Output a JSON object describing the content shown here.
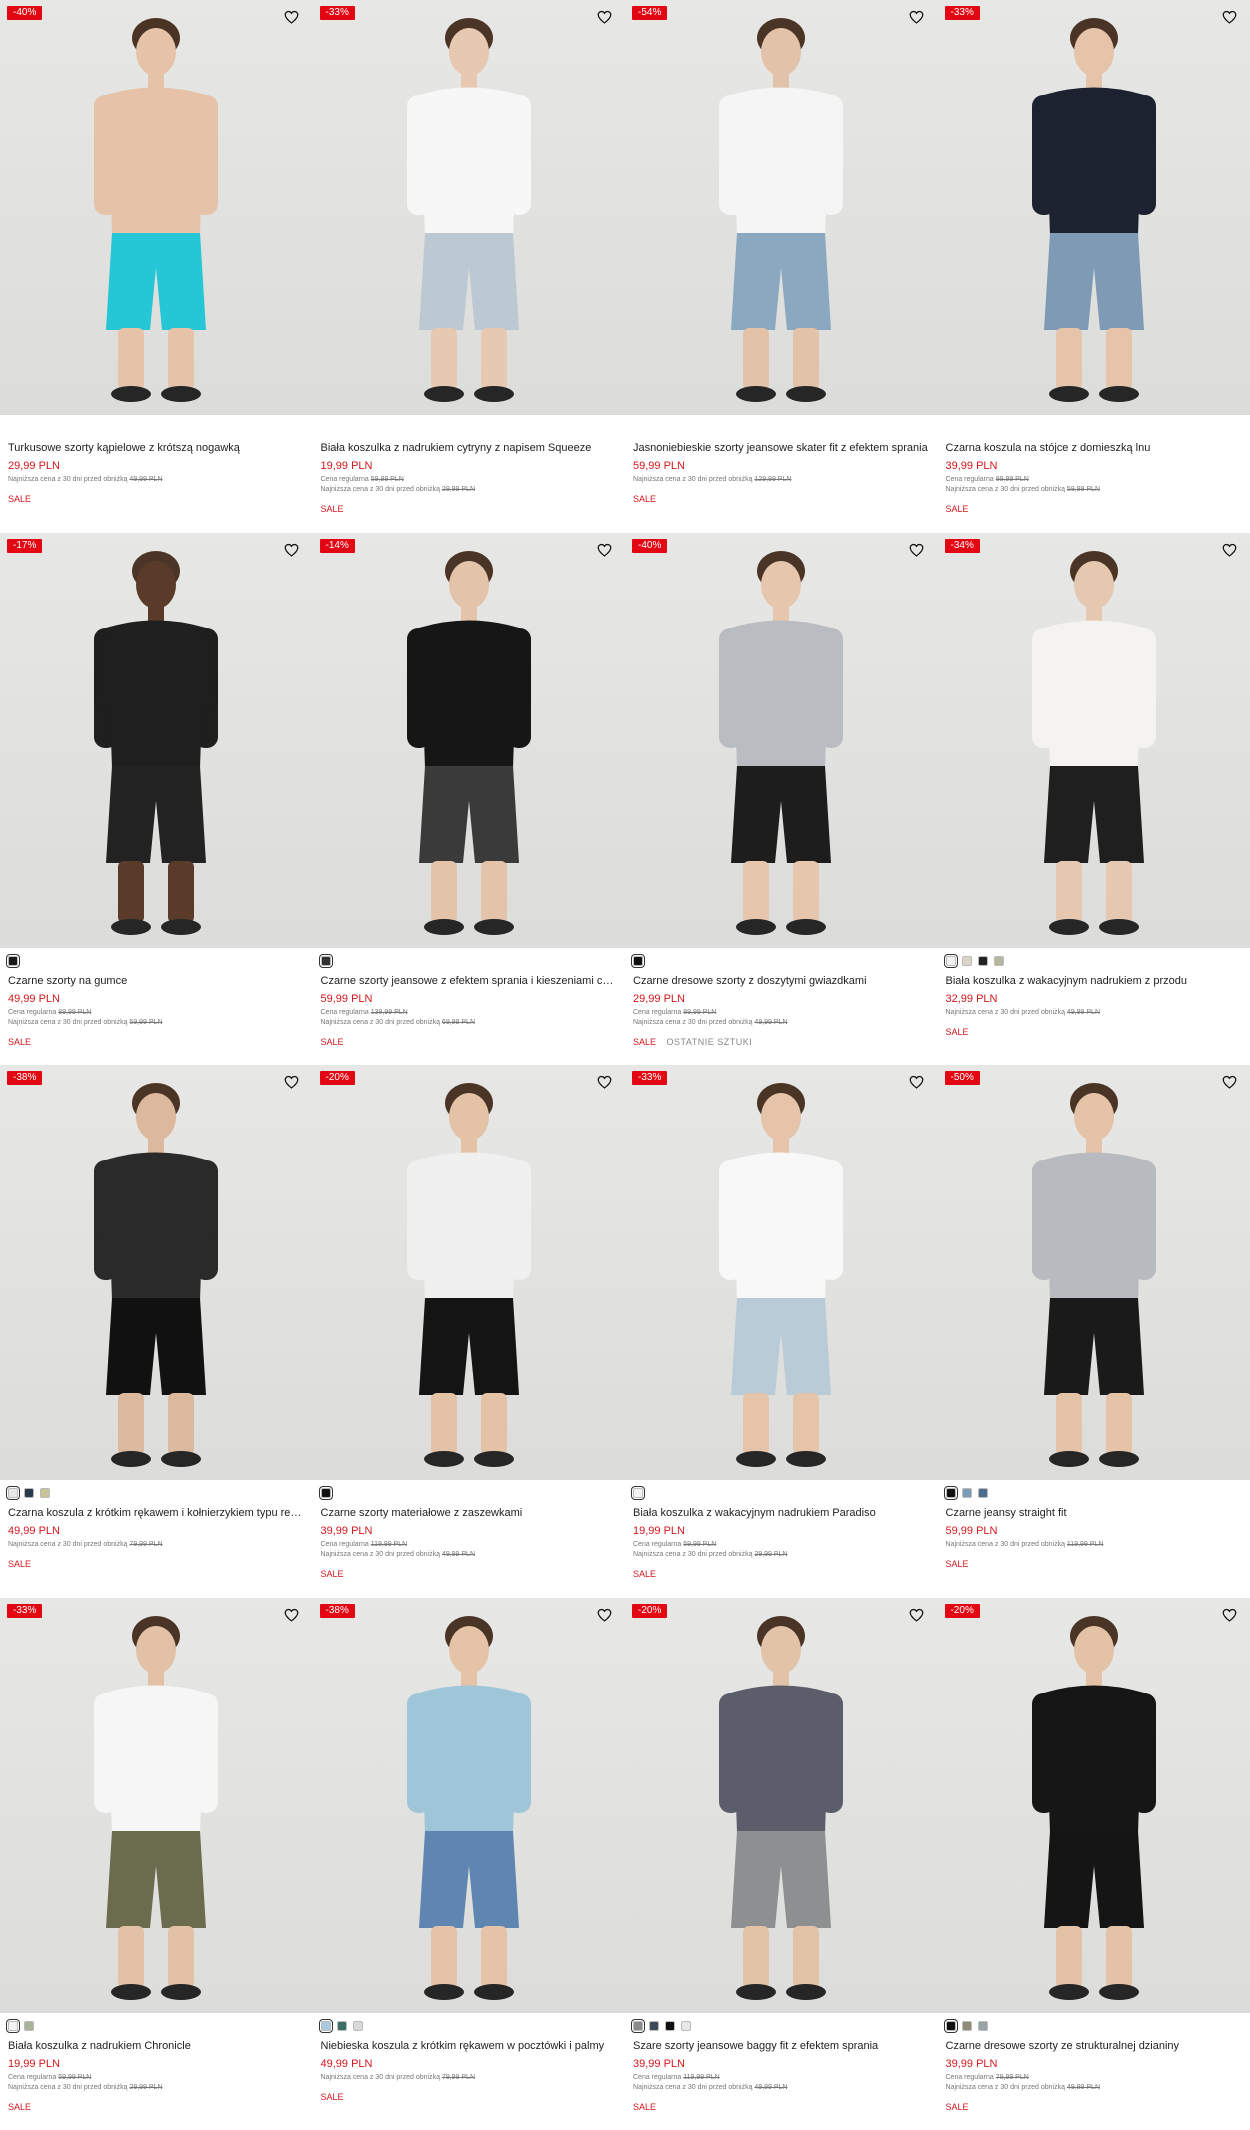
{
  "colors": {
    "accent": "#e30613",
    "price": "#d3171d",
    "muted": "#777777"
  },
  "labels": {
    "regular_prefix": "Cena regularna",
    "lowest_prefix": "Najniższa cena z 30 dni przed obniżką",
    "sale": "SALE"
  },
  "products": [
    {
      "badge": "-40%",
      "name": "Turkusowe szorty kąpielowe z krótszą nogawką",
      "price": "29,99 PLN",
      "regular": "",
      "lowest": "49,99 PLN",
      "swatches": [],
      "extra": "",
      "top": "#e8d2c2",
      "bottom": "#25c6d6",
      "skin": "#e6c3a8",
      "shirtless": true
    },
    {
      "badge": "-33%",
      "name": "Biała koszulka z nadrukiem cytryny z napisem Squeeze",
      "price": "19,99 PLN",
      "regular": "59,99 PLN",
      "lowest": "29,99 PLN",
      "swatches": [],
      "extra": "",
      "top": "#f7f7f7",
      "bottom": "#bcc9d3",
      "skin": "#e7c9b2"
    },
    {
      "badge": "-54%",
      "name": "Jasnoniebieskie szorty jeansowe skater fit z efektem sprania",
      "price": "59,99 PLN",
      "regular": "",
      "lowest": "129,99 PLN",
      "swatches": [],
      "extra": "",
      "top": "#f5f5f5",
      "bottom": "#8aa8bf",
      "skin": "#e2c2a8"
    },
    {
      "badge": "-33%",
      "name": "Czarna koszula na stójce z domieszką lnu",
      "price": "39,99 PLN",
      "regular": "99,99 PLN",
      "lowest": "59,99 PLN",
      "swatches": [],
      "extra": "",
      "top": "#1c2230",
      "bottom": "#7f9ab5",
      "skin": "#e5c4aa"
    },
    {
      "badge": "-17%",
      "name": "Czarne szorty na gumce",
      "price": "49,99 PLN",
      "regular": "89,99 PLN",
      "lowest": "59,99 PLN",
      "swatches": [
        "#1a1a1a"
      ],
      "extra": "",
      "top": "#1f1f1f",
      "bottom": "#222222",
      "skin": "#5a3b2a"
    },
    {
      "badge": "-14%",
      "name": "Czarne szorty jeansowe z efektem sprania i kieszeniami cargo",
      "price": "59,99 PLN",
      "regular": "139,99 PLN",
      "lowest": "69,99 PLN",
      "swatches": [
        "#333333"
      ],
      "extra": "",
      "top": "#161616",
      "bottom": "#3a3a3a",
      "skin": "#e3c3aa"
    },
    {
      "badge": "-40%",
      "name": "Czarne dresowe szorty z doszytymi gwiazdkami",
      "price": "29,99 PLN",
      "regular": "89,99 PLN",
      "lowest": "49,99 PLN",
      "swatches": [
        "#111111"
      ],
      "extra": "OSTATNIE SZTUKI",
      "top": "#b9bcc0",
      "bottom": "#1d1d1d",
      "skin": "#e6c6ad"
    },
    {
      "badge": "-34%",
      "name": "Biała koszulka z wakacyjnym nadrukiem z przodu",
      "price": "32,99 PLN",
      "regular": "",
      "lowest": "49,99 PLN",
      "swatches": [
        "#f2f2f2",
        "#d9d4c4",
        "#222222",
        "#b7b89a"
      ],
      "extra": "",
      "top": "#f4f3ef",
      "bottom": "#1f1f1f",
      "skin": "#e6c8b0"
    },
    {
      "badge": "-38%",
      "name": "Czarna koszula z krótkim rękawem i kołnierzykiem typu resort",
      "price": "49,99 PLN",
      "regular": "",
      "lowest": "79,99 PLN",
      "swatches": [
        "#e8e8e8",
        "#2b3a4a",
        "#c9c39a"
      ],
      "extra": "",
      "top": "#2a2a2a",
      "bottom": "#111111",
      "skin": "#dcb89c"
    },
    {
      "badge": "-20%",
      "name": "Czarne szorty materiałowe z zaszewkami",
      "price": "39,99 PLN",
      "regular": "119,99 PLN",
      "lowest": "49,99 PLN",
      "swatches": [
        "#111111"
      ],
      "extra": "",
      "top": "#f0f0f0",
      "bottom": "#141414",
      "skin": "#e3c2a6"
    },
    {
      "badge": "-33%",
      "name": "Biała koszulka z wakacyjnym nadrukiem Paradiso",
      "price": "19,99 PLN",
      "regular": "59,99 PLN",
      "lowest": "29,99 PLN",
      "swatches": [
        "#f3f3f3"
      ],
      "extra": "",
      "top": "#f8f8f8",
      "bottom": "#b9cbd6",
      "skin": "#e5c4a9"
    },
    {
      "badge": "-50%",
      "name": "Czarne jeansy straight fit",
      "price": "59,99 PLN",
      "regular": "",
      "lowest": "119,99 PLN",
      "swatches": [
        "#111111",
        "#7d9bb5",
        "#4e6d8c"
      ],
      "extra": "",
      "top": "#b7babe",
      "bottom": "#1a1a1a",
      "skin": "#e4c3a7"
    },
    {
      "badge": "-33%",
      "name": "Biała koszulka z nadrukiem Chronicle",
      "price": "19,99 PLN",
      "regular": "59,99 PLN",
      "lowest": "29,99 PLN",
      "swatches": [
        "#f3f3f3",
        "#a9b39a"
      ],
      "extra": "",
      "top": "#f6f6f6",
      "bottom": "#6b6b4e",
      "skin": "#e2c1a6"
    },
    {
      "badge": "-38%",
      "name": "Niebieska koszula z krótkim rękawem w pocztówki i palmy",
      "price": "49,99 PLN",
      "regular": "",
      "lowest": "79,99 PLN",
      "swatches": [
        "#a8c9e0",
        "#3d6f6a",
        "#d8d8d8"
      ],
      "extra": "",
      "top": "#9fc6d8",
      "bottom": "#5f86b0",
      "skin": "#e4c3a6"
    },
    {
      "badge": "-20%",
      "name": "Szare szorty jeansowe baggy fit z efektem sprania",
      "price": "39,99 PLN",
      "regular": "119,99 PLN",
      "lowest": "49,99 PLN",
      "swatches": [
        "#8a8a8a",
        "#3c4a5a",
        "#111111",
        "#e8e8e8"
      ],
      "extra": "",
      "top": "#5b5e6a",
      "bottom": "#8e8f91",
      "skin": "#e3c3a8"
    },
    {
      "badge": "-20%",
      "name": "Czarne dresowe szorty ze strukturalnej dzianiny",
      "price": "39,99 PLN",
      "regular": "79,99 PLN",
      "lowest": "49,99 PLN",
      "swatches": [
        "#111111",
        "#8f8a78",
        "#9aa3a6"
      ],
      "extra": "",
      "top": "#161616",
      "bottom": "#151515",
      "skin": "#e4c2a6"
    }
  ]
}
